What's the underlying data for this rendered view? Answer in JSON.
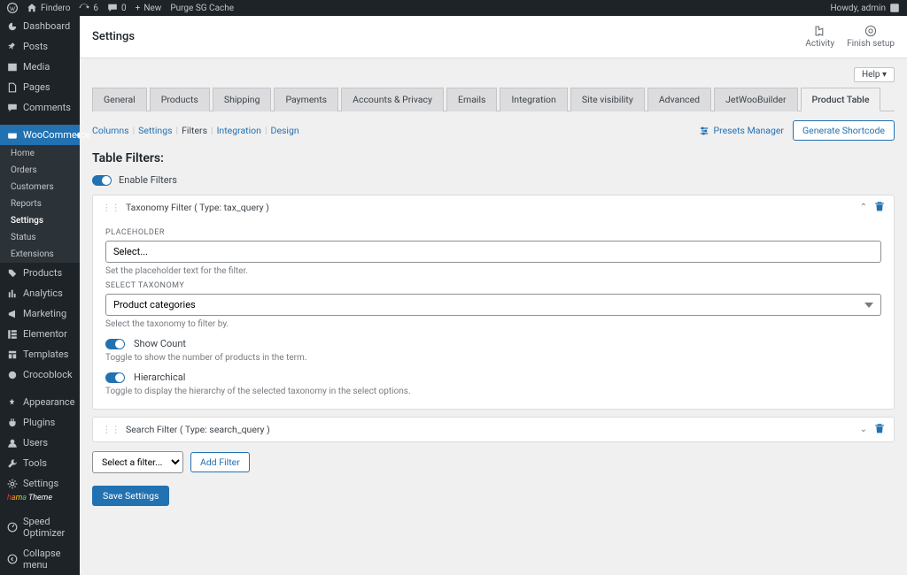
{
  "adminbar": {
    "site": "Findero",
    "updates": "6",
    "comments": "0",
    "new": "New",
    "purge": "Purge SG Cache",
    "howdy": "Howdy, admin"
  },
  "sidebar": {
    "items": [
      {
        "icon": "dashboard",
        "label": "Dashboard"
      },
      {
        "icon": "pin",
        "label": "Posts"
      },
      {
        "icon": "media",
        "label": "Media"
      },
      {
        "icon": "page",
        "label": "Pages"
      },
      {
        "icon": "comment",
        "label": "Comments"
      },
      {
        "icon": "woo",
        "label": "WooCommerce",
        "active": true
      },
      {
        "icon": "products",
        "label": "Products"
      },
      {
        "icon": "analytics",
        "label": "Analytics"
      },
      {
        "icon": "marketing",
        "label": "Marketing"
      },
      {
        "icon": "elementor",
        "label": "Elementor"
      },
      {
        "icon": "templates",
        "label": "Templates"
      },
      {
        "icon": "crocoblock",
        "label": "Crocoblock"
      },
      {
        "icon": "appearance",
        "label": "Appearance"
      },
      {
        "icon": "plugins",
        "label": "Plugins"
      },
      {
        "icon": "users",
        "label": "Users"
      },
      {
        "icon": "tools",
        "label": "Tools"
      },
      {
        "icon": "settings",
        "label": "Settings"
      },
      {
        "icon": "speed",
        "label": "Speed Optimizer"
      },
      {
        "icon": "collapse",
        "label": "Collapse menu"
      }
    ],
    "woo_sub": [
      "Home",
      "Orders",
      "Customers",
      "Reports",
      "Settings",
      "Status",
      "Extensions"
    ],
    "woo_sub_active": "Settings",
    "theme_label": "Theme"
  },
  "header": {
    "title": "Settings",
    "activity": "Activity",
    "finish": "Finish setup",
    "help": "Help"
  },
  "tabs": [
    "General",
    "Products",
    "Shipping",
    "Payments",
    "Accounts & Privacy",
    "Emails",
    "Integration",
    "Site visibility",
    "Advanced",
    "JetWooBuilder",
    "Product Table"
  ],
  "active_tab": "Product Table",
  "subtabs": [
    "Columns",
    "Settings",
    "Filters",
    "Integration",
    "Design"
  ],
  "active_subtab": "Filters",
  "presets": "Presets Manager",
  "generate": "Generate Shortcode",
  "section": {
    "title": "Table Filters:",
    "enable_label": "Enable Filters"
  },
  "filter1": {
    "title": "Taxonomy Filter ( Type: tax_query )",
    "placeholder_label": "PLACEHOLDER",
    "placeholder_value": "Select...",
    "placeholder_hint": "Set the placeholder text for the filter.",
    "taxonomy_label": "SELECT TAXONOMY",
    "taxonomy_value": "Product categories",
    "taxonomy_hint": "Select the taxonomy to filter by.",
    "showcount_label": "Show Count",
    "showcount_hint": "Toggle to show the number of products in the term.",
    "hierarchical_label": "Hierarchical",
    "hierarchical_hint": "Toggle to display the hierarchy of the selected taxonomy in the select options."
  },
  "filter2": {
    "title": "Search Filter ( Type: search_query )"
  },
  "bottom": {
    "select": "Select a filter...",
    "add": "Add Filter",
    "save": "Save Settings"
  }
}
